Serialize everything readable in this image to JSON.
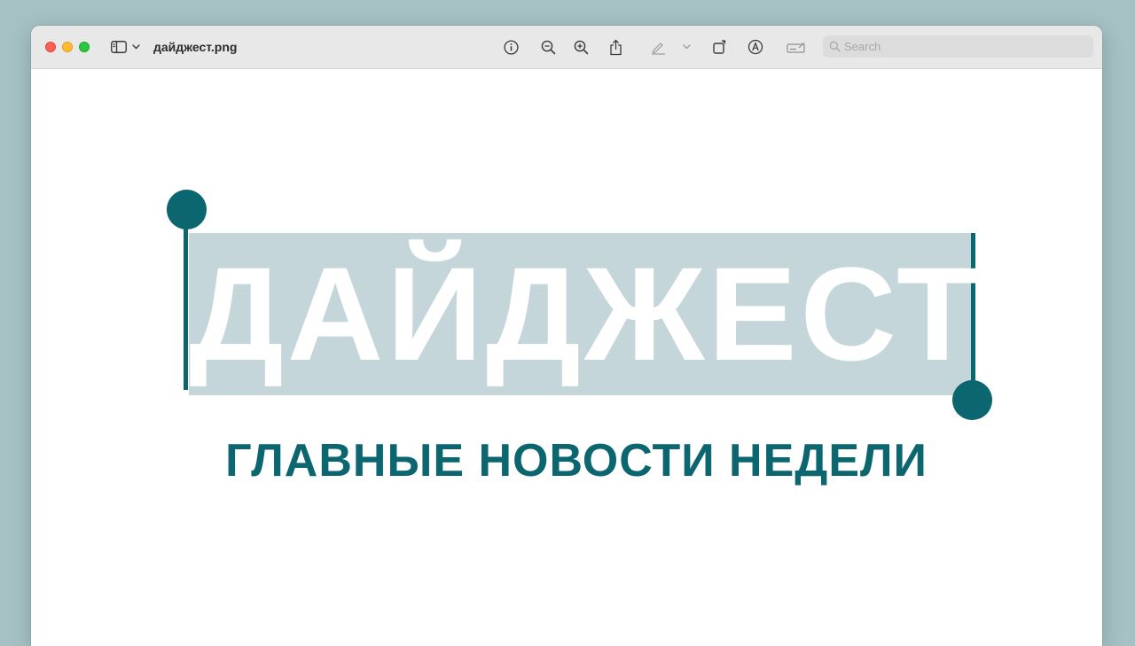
{
  "window": {
    "filename": "дайджест.png"
  },
  "toolbar": {
    "icons": {
      "sidebar": "sidebar-toggle-icon",
      "chevron": "chevron-down-icon",
      "info": "info-icon",
      "zoom_out": "zoom-out-icon",
      "zoom_in": "zoom-in-icon",
      "share": "share-icon",
      "markup": "pen-icon",
      "rotate": "rotate-icon",
      "annotate": "markup-circle-a-icon",
      "form": "form-fill-icon",
      "search": "magnifier-icon"
    },
    "search_placeholder": "Search"
  },
  "document": {
    "headline": "ДАЙДЖЕСТ",
    "subheadline": "ГЛАВНЫЕ НОВОСТИ НЕДЕЛИ"
  },
  "colors": {
    "accent_teal": "#0b6670",
    "highlight_box": "#c5d6db",
    "desktop_bg": "#a5c1c3",
    "close": "#fe5f57",
    "minimize": "#febc2e",
    "zoom": "#28c840"
  }
}
